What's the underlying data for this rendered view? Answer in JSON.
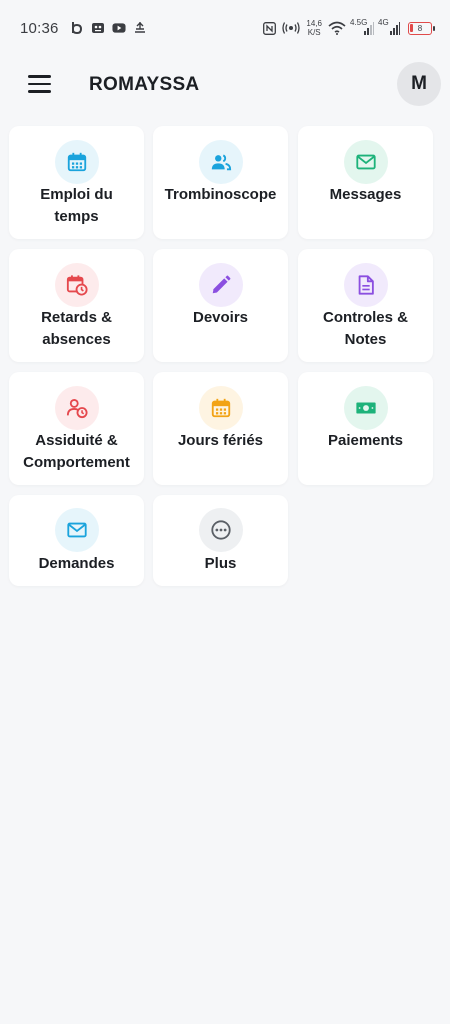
{
  "status_bar": {
    "time": "10:36",
    "net_speed_value": "14,6",
    "net_speed_unit": "K/S",
    "sim1_label": "4.5G",
    "sim2_label": "4G",
    "battery_level": "8",
    "icons": [
      "b-app-icon",
      "avatar-app-icon",
      "youtube-icon",
      "weather-icon",
      "nfc-icon",
      "hotspot-icon",
      "wifi-icon",
      "signal-icon",
      "signal-icon",
      "battery-icon"
    ]
  },
  "app_bar": {
    "title": "ROMAYSSA",
    "avatar_initial": "M",
    "menu_icon": "hamburger-menu-icon"
  },
  "colors": {
    "background": "#f6f7f9",
    "tile": "#ffffff",
    "blue": "#1aa3dc",
    "green": "#1db27a",
    "red": "#e5484d",
    "purple": "#8b4fe0",
    "orange": "#f2a316",
    "gray": "#5a5f66"
  },
  "tiles": [
    {
      "label_1": "Emploi du",
      "label_2": "temps",
      "icon": "calendar-icon",
      "color": "#1aa3dc",
      "bg": "#e6f5fb"
    },
    {
      "label_1": "Trombinoscope",
      "icon": "people-icon",
      "color": "#1aa3dc",
      "bg": "#e6f5fb"
    },
    {
      "label_1": "Messages",
      "icon": "mail-icon",
      "color": "#1db27a",
      "bg": "#e3f6ee"
    },
    {
      "label_1": "Retards &",
      "label_2": "absences",
      "icon": "calendar-clock-icon",
      "color": "#e5484d",
      "bg": "#fdebec"
    },
    {
      "label_1": "Devoirs",
      "icon": "pencil-icon",
      "color": "#8b4fe0",
      "bg": "#f1eafc"
    },
    {
      "label_1": "Controles &",
      "label_2": "Notes",
      "icon": "document-icon",
      "color": "#8b4fe0",
      "bg": "#f1eafc"
    },
    {
      "label_1": "Assiduité &",
      "label_2": "Comportement",
      "icon": "person-clock-icon",
      "color": "#e5484d",
      "bg": "#fdebec"
    },
    {
      "label_1": "Jours fériés",
      "icon": "calendar-icon",
      "color": "#f2a316",
      "bg": "#fef4e2"
    },
    {
      "label_1": "Paiements",
      "icon": "money-icon",
      "color": "#1db27a",
      "bg": "#e3f6ee"
    },
    {
      "label_1": "Demandes",
      "icon": "mail-icon",
      "color": "#1aa3dc",
      "bg": "#e6f5fb"
    },
    {
      "label_1": "Plus",
      "icon": "more-icon",
      "color": "#5a5f66",
      "bg": "#eef0f2"
    }
  ]
}
